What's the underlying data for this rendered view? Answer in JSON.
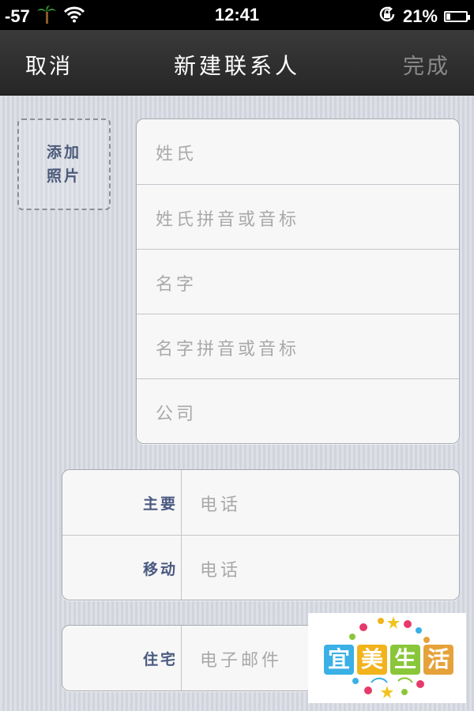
{
  "status_bar": {
    "signal": "-57",
    "time": "12:41",
    "battery_percent": "21%",
    "battery_level": 0.21
  },
  "nav": {
    "cancel": "取消",
    "title": "新建联系人",
    "done": "完成"
  },
  "photo": {
    "label": "添加照片"
  },
  "name_fields": [
    {
      "placeholder": "姓氏"
    },
    {
      "placeholder": "姓氏拼音或音标"
    },
    {
      "placeholder": "名字"
    },
    {
      "placeholder": "名字拼音或音标"
    },
    {
      "placeholder": "公司"
    }
  ],
  "phone_fields": [
    {
      "label": "主要",
      "placeholder": "电话"
    },
    {
      "label": "移动",
      "placeholder": "电话"
    }
  ],
  "email_field": {
    "label": "住宅",
    "placeholder": "电子邮件"
  },
  "watermark": {
    "text": "宜美生活"
  },
  "colors": {
    "nav_bg": "#2f2f2f",
    "label_blue": "#4a5a80",
    "placeholder": "#a9a9a9",
    "page_bg": "#d6d9e1"
  }
}
